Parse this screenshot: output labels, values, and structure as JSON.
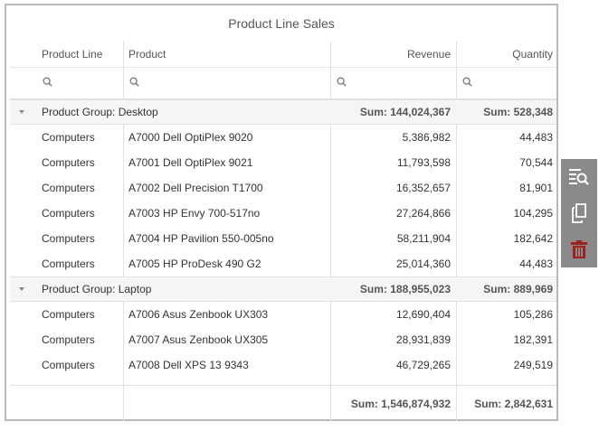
{
  "title": "Product Line Sales",
  "columns": {
    "product_line": "Product Line",
    "product": "Product",
    "revenue": "Revenue",
    "quantity": "Quantity"
  },
  "groups": [
    {
      "label": "Product Group: Desktop",
      "revenue_sum": "Sum: 144,024,367",
      "quantity_sum": "Sum: 528,348",
      "rows": [
        {
          "line": "Computers",
          "product": "A7000 Dell OptiPlex 9020",
          "revenue": "5,386,982",
          "quantity": "44,483"
        },
        {
          "line": "Computers",
          "product": "A7001 Dell OptiPlex 9021",
          "revenue": "11,793,598",
          "quantity": "70,544"
        },
        {
          "line": "Computers",
          "product": "A7002 Dell Precision T1700",
          "revenue": "16,352,657",
          "quantity": "81,901"
        },
        {
          "line": "Computers",
          "product": "A7003 HP Envy 700-517no",
          "revenue": "27,264,866",
          "quantity": "104,295"
        },
        {
          "line": "Computers",
          "product": "A7004 HP Pavilion 550-005no",
          "revenue": "58,211,904",
          "quantity": "182,642"
        },
        {
          "line": "Computers",
          "product": "A7005 HP ProDesk 490 G2",
          "revenue": "25,014,360",
          "quantity": "44,483"
        }
      ]
    },
    {
      "label": "Product Group: Laptop",
      "revenue_sum": "Sum: 188,955,023",
      "quantity_sum": "Sum: 889,969",
      "rows": [
        {
          "line": "Computers",
          "product": "A7006 Asus Zenbook UX303",
          "revenue": "12,690,404",
          "quantity": "105,286"
        },
        {
          "line": "Computers",
          "product": "A7007 Asus Zenbook UX305",
          "revenue": "28,931,839",
          "quantity": "182,391"
        },
        {
          "line": "Computers",
          "product": "A7008 Dell XPS 13 9343",
          "revenue": "46,729,265",
          "quantity": "249,519"
        }
      ]
    }
  ],
  "totals": {
    "revenue_sum": "Sum: 1,546,874,932",
    "quantity_sum": "Sum: 2,842,631"
  },
  "toolbar": {
    "icons": [
      "table-search-icon",
      "copy-icon",
      "trash-icon"
    ],
    "delete_color": "#a02020"
  }
}
